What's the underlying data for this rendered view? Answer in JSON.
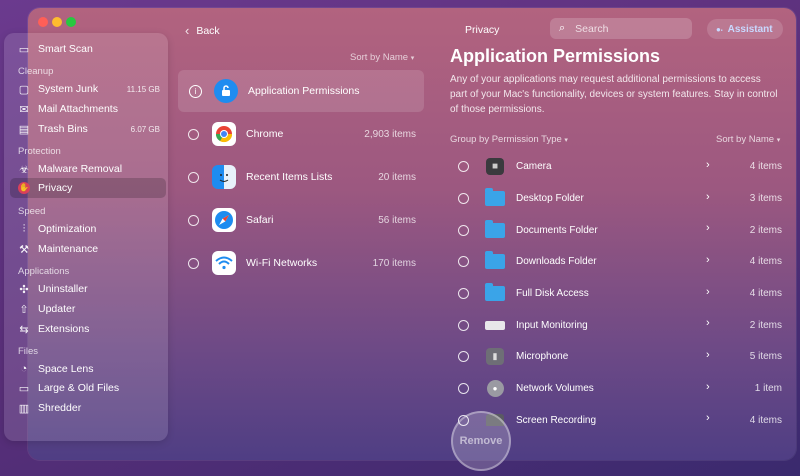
{
  "sidebar": {
    "top": {
      "label": "Smart Scan",
      "icon": "smart-scan-icon"
    },
    "sections": [
      {
        "title": "Cleanup"
      },
      {
        "title": "Protection"
      },
      {
        "title": "Speed"
      },
      {
        "title": "Applications"
      },
      {
        "title": "Files"
      }
    ],
    "items": [
      {
        "label": "System Junk",
        "size": "11.15 GB",
        "icon": "system-junk-icon"
      },
      {
        "label": "Mail Attachments",
        "size": "",
        "icon": "mail-icon"
      },
      {
        "label": "Trash Bins",
        "size": "6.07 GB",
        "icon": "trash-icon"
      },
      {
        "label": "Malware Removal",
        "size": "",
        "icon": "biohazard-icon"
      },
      {
        "label": "Privacy",
        "size": "",
        "icon": "privacy-hand-icon"
      },
      {
        "label": "Optimization",
        "size": "",
        "icon": "sliders-icon"
      },
      {
        "label": "Maintenance",
        "size": "",
        "icon": "wrench-icon"
      },
      {
        "label": "Uninstaller",
        "size": "",
        "icon": "uninstaller-icon"
      },
      {
        "label": "Updater",
        "size": "",
        "icon": "updater-icon"
      },
      {
        "label": "Extensions",
        "size": "",
        "icon": "extensions-icon"
      },
      {
        "label": "Space Lens",
        "size": "",
        "icon": "space-lens-icon"
      },
      {
        "label": "Large & Old Files",
        "size": "",
        "icon": "folder-icon"
      },
      {
        "label": "Shredder",
        "size": "",
        "icon": "shredder-icon"
      }
    ]
  },
  "topbar": {
    "back": "Back",
    "title": "Privacy",
    "search_placeholder": "Search",
    "assistant": "Assistant"
  },
  "middle": {
    "sort_label": "Sort by Name",
    "items": [
      {
        "label": "Application Permissions",
        "count": ""
      },
      {
        "label": "Chrome",
        "count": "2,903 items"
      },
      {
        "label": "Recent Items Lists",
        "count": "20 items"
      },
      {
        "label": "Safari",
        "count": "56 items"
      },
      {
        "label": "Wi-Fi Networks",
        "count": "170 items"
      }
    ]
  },
  "right": {
    "title": "Application Permissions",
    "description": "Any of your applications may request additional permissions to access part of your Mac's functionality, devices or system features. Stay in control of those permissions.",
    "group_label": "Group by Permission Type",
    "sort_label": "Sort by Name",
    "rows": [
      {
        "label": "Camera",
        "count": "4 items"
      },
      {
        "label": "Desktop Folder",
        "count": "3 items"
      },
      {
        "label": "Documents Folder",
        "count": "2 items"
      },
      {
        "label": "Downloads Folder",
        "count": "4 items"
      },
      {
        "label": "Full Disk Access",
        "count": "4 items"
      },
      {
        "label": "Input Monitoring",
        "count": "2 items"
      },
      {
        "label": "Microphone",
        "count": "5 items"
      },
      {
        "label": "Network Volumes",
        "count": "1 item"
      },
      {
        "label": "Screen Recording",
        "count": "4 items"
      }
    ]
  },
  "remove_button": "Remove",
  "colors": {
    "accent": "#c8d9ff",
    "folder": "#3aa4e8",
    "safari": "#1e8cf0",
    "chrome_red": "#ea4335"
  }
}
